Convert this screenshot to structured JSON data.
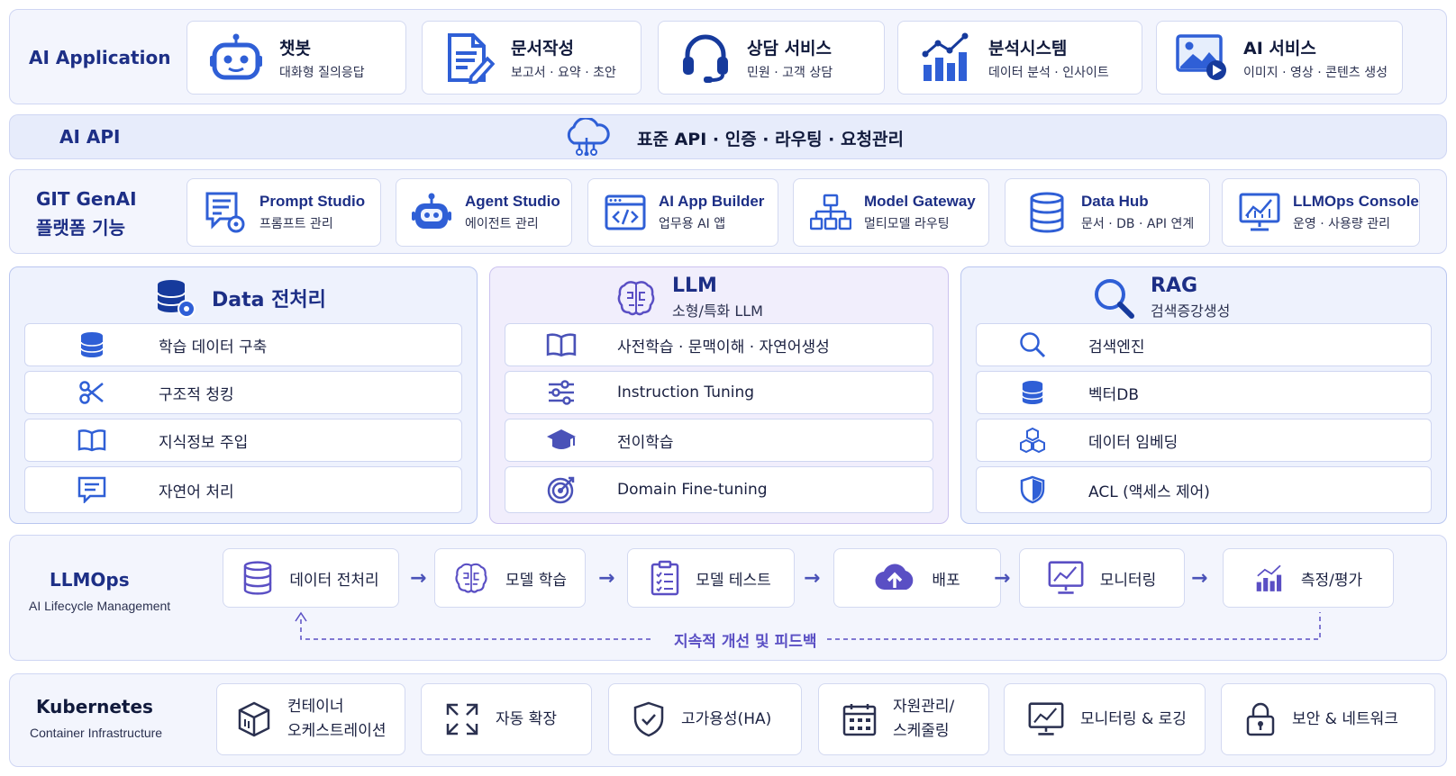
{
  "app_layer": {
    "title": "AI Application",
    "cards": [
      {
        "title": "챗봇",
        "sub": "대화형 질의응답",
        "icon": "robot-icon"
      },
      {
        "title": "문서작성",
        "sub": "보고서 · 요약 · 초안",
        "icon": "document-edit-icon"
      },
      {
        "title": "상담 서비스",
        "sub": "민원 · 고객 상담",
        "icon": "headset-icon"
      },
      {
        "title": "분석시스템",
        "sub": "데이터 분석 · 인사이트",
        "icon": "bar-chart-icon"
      },
      {
        "title": "AI 서비스",
        "sub": "이미지 · 영상 · 콘텐츠 생성",
        "icon": "image-video-icon"
      }
    ]
  },
  "api_layer": {
    "title": "AI API",
    "description": "표준 API · 인증 · 라우팅 · 요청관리",
    "icon": "cloud-network-icon"
  },
  "platform_layer": {
    "title_line1": "GIT GenAI",
    "title_line2": "플랫폼 기능",
    "cards": [
      {
        "title": "Prompt Studio",
        "sub": "프롬프트 관리",
        "icon": "prompt-gear-icon"
      },
      {
        "title": "Agent Studio",
        "sub": "에이전트 관리",
        "icon": "agent-robot-icon"
      },
      {
        "title": "AI App Builder",
        "sub": "업무용 AI 앱",
        "icon": "code-window-icon"
      },
      {
        "title": "Model Gateway",
        "sub": "멀티모델 라우팅",
        "icon": "hierarchy-icon"
      },
      {
        "title": "Data Hub",
        "sub": "문서 · DB · API 연계",
        "icon": "database-icon"
      },
      {
        "title": "LLMOps Console",
        "sub": "운영 · 사용량 관리",
        "icon": "monitor-chart-icon"
      }
    ]
  },
  "panels": {
    "data": {
      "title": "Data 전처리",
      "rows": [
        {
          "label": "학습 데이터 구축",
          "icon": "database-icon"
        },
        {
          "label": "구조적 청킹",
          "icon": "scissors-icon"
        },
        {
          "label": "지식정보 주입",
          "icon": "book-icon"
        },
        {
          "label": "자연어 처리",
          "icon": "chat-lines-icon"
        }
      ]
    },
    "llm": {
      "title": "LLM",
      "subtitle": "소형/특화 LLM",
      "rows": [
        {
          "label": "사전학습 · 문맥이해 · 자연어생성",
          "icon": "book-icon"
        },
        {
          "label": "Instruction Tuning",
          "icon": "sliders-icon"
        },
        {
          "label": "전이학습",
          "icon": "graduation-cap-icon"
        },
        {
          "label": "Domain Fine-tuning",
          "icon": "target-icon"
        }
      ]
    },
    "rag": {
      "title": "RAG",
      "subtitle": "검색증강생성",
      "rows": [
        {
          "label": "검색엔진",
          "icon": "search-icon"
        },
        {
          "label": "벡터DB",
          "icon": "database-icon"
        },
        {
          "label": "데이터 임베딩",
          "icon": "cubes-icon"
        },
        {
          "label": "ACL (액세스 제어)",
          "icon": "shield-icon"
        }
      ]
    }
  },
  "llmops": {
    "title": "LLMOps",
    "subtitle": "AI Lifecycle Management",
    "steps": [
      {
        "label": "데이터 전처리",
        "icon": "database-icon"
      },
      {
        "label": "모델 학습",
        "icon": "brain-icon"
      },
      {
        "label": "모델 테스트",
        "icon": "clipboard-check-icon"
      },
      {
        "label": "배포",
        "icon": "cloud-upload-icon"
      },
      {
        "label": "모니터링",
        "icon": "monitor-chart-icon"
      },
      {
        "label": "측정/평가",
        "icon": "bar-chart-icon"
      }
    ],
    "feedback": "지속적 개선 및 피드백"
  },
  "kubernetes": {
    "title": "Kubernetes",
    "subtitle": "Container Infrastructure",
    "cards": [
      {
        "label": "컨테이너\n오케스트레이션",
        "icon": "container-box-icon"
      },
      {
        "label": "자동 확장",
        "icon": "expand-arrows-icon"
      },
      {
        "label": "고가용성(HA)",
        "icon": "shield-check-icon"
      },
      {
        "label": "자원관리/\n스케줄링",
        "icon": "calendar-icon"
      },
      {
        "label": "모니터링 & 로깅",
        "icon": "monitor-chart-icon"
      },
      {
        "label": "보안 & 네트워크",
        "icon": "lock-icon"
      }
    ]
  },
  "colors": {
    "navy": "#1d2f86",
    "accent": "#2f5fd6",
    "purple": "#5a4fc4",
    "band_bg": "#f3f5fd"
  }
}
